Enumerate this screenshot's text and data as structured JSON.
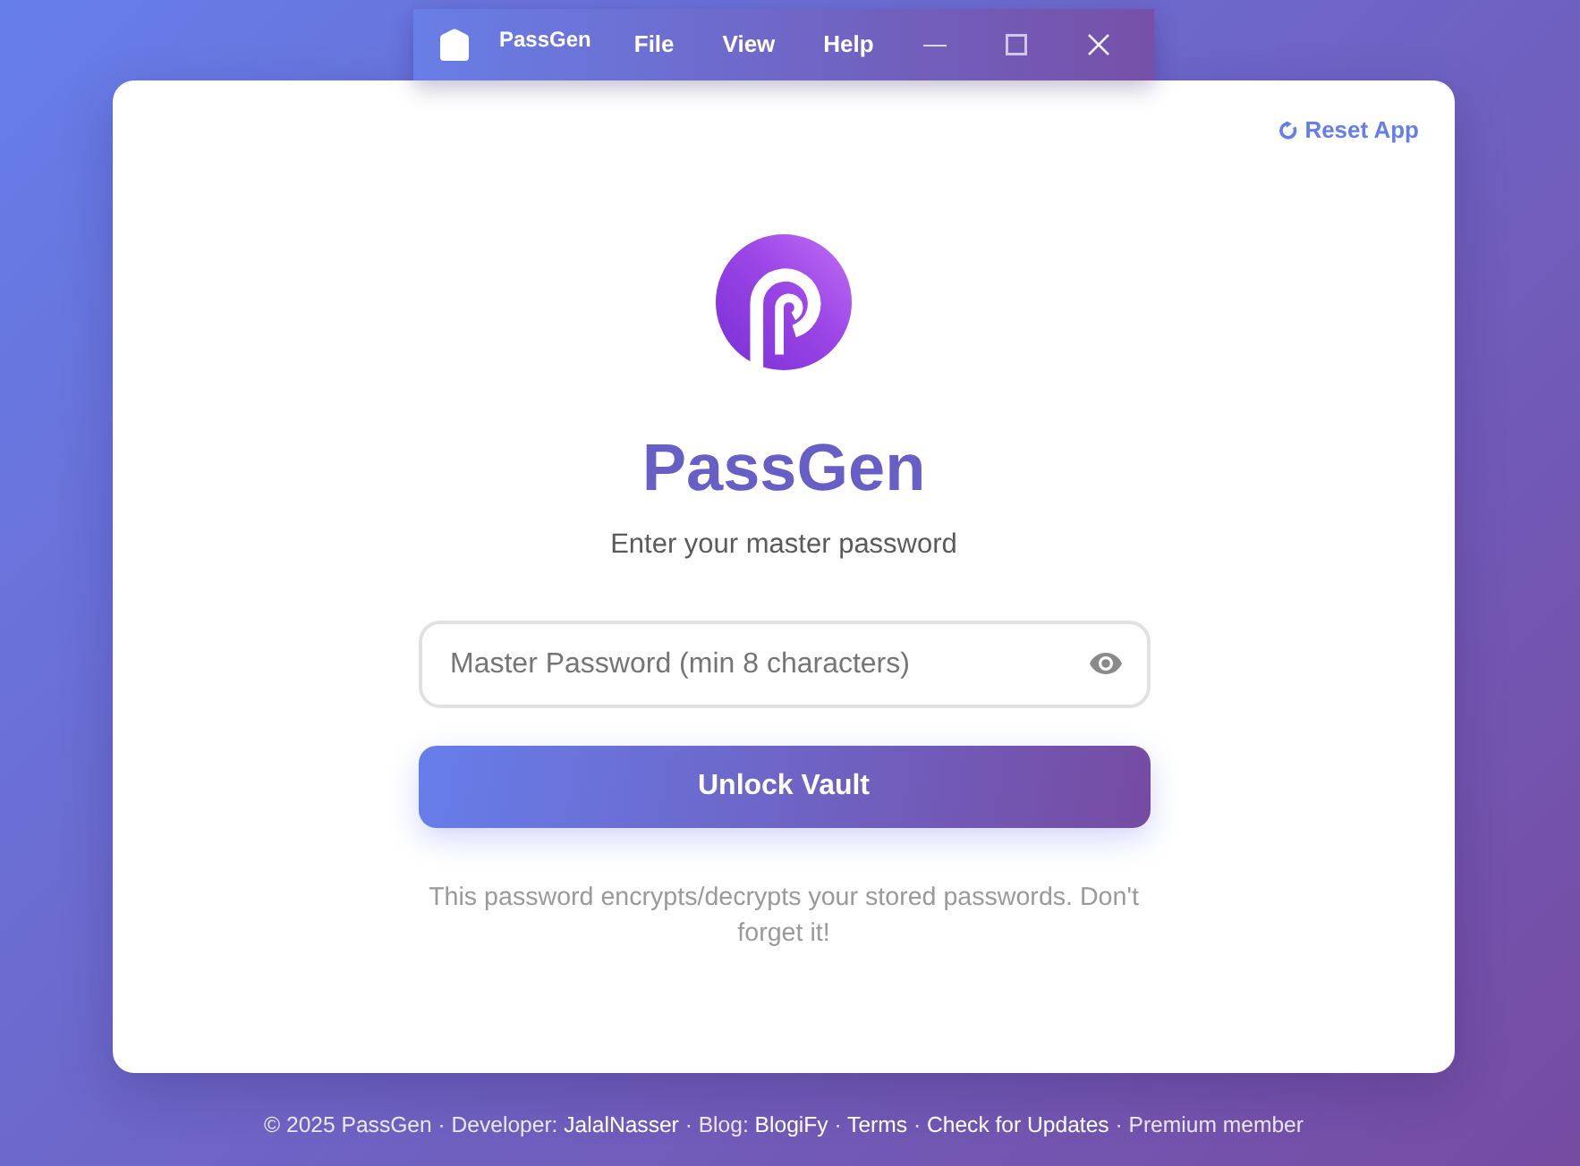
{
  "titlebar": {
    "app_name": "PassGen",
    "menus": [
      "File",
      "View",
      "Help"
    ],
    "controls": [
      {
        "kind": "minimize"
      },
      {
        "kind": "maximize"
      },
      {
        "kind": "close"
      }
    ]
  },
  "reset_link": {
    "label": "Reset App"
  },
  "brand": {
    "title": "PassGen",
    "subtitle": "Enter your master password"
  },
  "password_field": {
    "placeholder": "Master Password (min 8 characters)"
  },
  "unlock_button": {
    "label": "Unlock Vault"
  },
  "hint": "This password encrypts/decrypts your stored passwords. Don't forget it!",
  "footer": {
    "parts": [
      {
        "kind": "text",
        "text": "© 2025 PassGen · Developer:"
      },
      {
        "kind": "link",
        "text": "JalalNasser"
      },
      {
        "kind": "text",
        "text": "· Blog:"
      },
      {
        "kind": "link",
        "text": "BlogiFy"
      },
      {
        "kind": "text",
        "text": "·"
      },
      {
        "kind": "link",
        "text": "Terms"
      },
      {
        "kind": "text",
        "text": "·"
      },
      {
        "kind": "link",
        "text": "Check for Updates"
      },
      {
        "kind": "text",
        "text": "· Premium member"
      }
    ]
  }
}
